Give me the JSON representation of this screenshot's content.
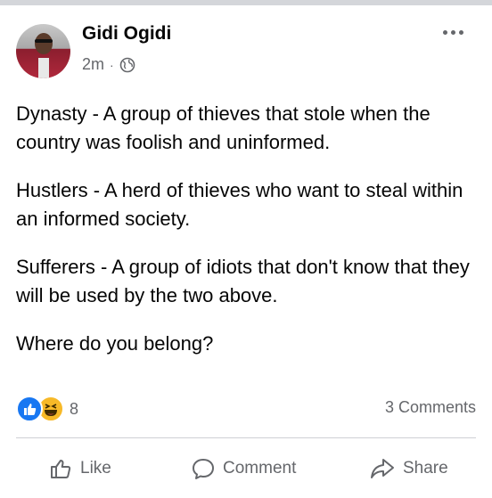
{
  "post": {
    "author": "Gidi Ogidi",
    "time": "2m",
    "separator": "·",
    "privacy_icon": "globe-icon",
    "paragraphs": [
      "Dynasty - A group of thieves that stole when the country was foolish and uninformed.",
      "Hustlers - A herd of thieves who want to steal within an informed society.",
      "Sufferers - A group of idiots that don't  know that they will be used by the two above.",
      "Where do you belong?"
    ]
  },
  "reactions": {
    "icons": [
      "like-reaction-icon",
      "haha-reaction-icon"
    ],
    "count": "8",
    "comments": "3 Comments"
  },
  "actions": {
    "like": "Like",
    "comment": "Comment",
    "share": "Share"
  },
  "colors": {
    "like_blue": "#1877f2",
    "haha_yellow": "#f7b928",
    "secondary_text": "#65676b"
  }
}
